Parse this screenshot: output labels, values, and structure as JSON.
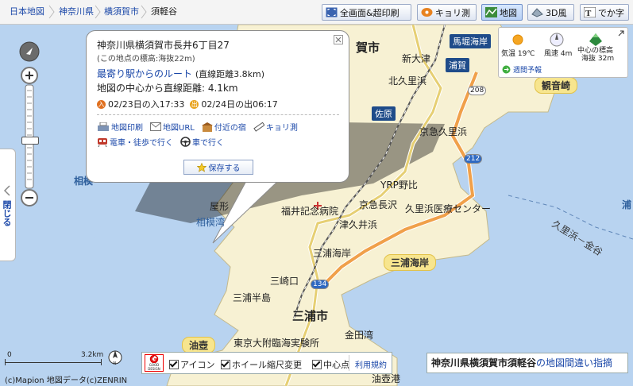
{
  "breadcrumb": [
    "日本地図",
    "神奈川県",
    "横須賀市",
    "須軽谷"
  ],
  "toolbar": {
    "fullscreen": "全画面&超印刷",
    "kyorisoku": "キョリ測",
    "map": "地図",
    "view3d": "3D風",
    "bigtext": "でか字"
  },
  "popup": {
    "address": "神奈川県横須賀市長井6丁目27",
    "elevation": "(この地点の標高:海抜22m)",
    "route_link": "最寄り駅からのルート",
    "route_distance": "(直線距離3.8km)",
    "center_distance": "地図の中心から直線距離: 4.1km",
    "sunset": "02/23日の入17:33",
    "sunrise": "02/24日の出06:17",
    "sunset_icon": "入",
    "sunrise_icon": "出",
    "print": "地図印刷",
    "map_url": "地図URL",
    "nearby_inn": "付近の宿",
    "kyorisoku": "キョリ測",
    "train_walk": "電車・徒歩で行く",
    "car": "車で行く",
    "save": "保存する"
  },
  "weather": {
    "temperature": "気温 19℃",
    "wind": "風速 4m",
    "center_elevation_label": "中心の標高",
    "center_elevation": "海抜 32m",
    "weekly_forecast": "週間予報"
  },
  "side_handle": "閉じる",
  "map_labels": {
    "cities": [
      "賀市",
      "三浦市"
    ],
    "stations": [
      "馬堀海岸",
      "浦賀",
      "佐原",
      "京急久里浜",
      "YRP野比",
      "京急長沢",
      "津久井浜",
      "三浦海岸",
      "三崎口"
    ],
    "areas": [
      "観音崎",
      "三浦海岸",
      "油壺"
    ],
    "towns": [
      "新大津",
      "北久里浜",
      "久里浜医療センター",
      "福井記念病院",
      "三浦半島",
      "金田湾",
      "東京大附臨海実験所",
      "久里浜－金谷",
      "屋形",
      "相模湾",
      "相模",
      "浦",
      "油壺港"
    ],
    "road_shields": [
      "208",
      "212",
      "134"
    ],
    "labels_partial": [
      "三浦",
      "石"
    ]
  },
  "scale": {
    "label": "3.2km",
    "start": "0"
  },
  "copyright": "(c)Mapion 地図データ(c)ZENRIN",
  "bottom_bar": {
    "good_design_line1": "GOOD",
    "good_design_line2": "DESIGN",
    "icon_label": "アイコン",
    "wheel_label": "ホイール縮尺変更",
    "center_label": "中心点",
    "terms": "利用規約"
  },
  "address_bar": {
    "address": "神奈川県横須賀市須軽谷",
    "error_link": "の地図間違い指摘"
  },
  "colors": {
    "sea": "#b8d3f0",
    "land": "#f7f1d3",
    "station": "#1f4c8a",
    "link": "#1a47a8",
    "route": "#cc3333"
  }
}
